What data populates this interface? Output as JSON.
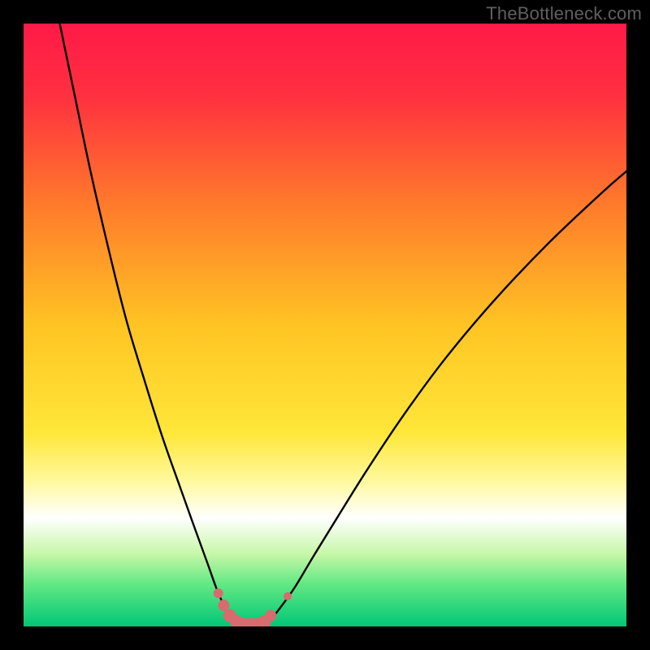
{
  "watermark": "TheBottleneck.com",
  "chart_data": {
    "type": "line",
    "title": "",
    "xlabel": "",
    "ylabel": "",
    "xlim": [
      0,
      100
    ],
    "ylim": [
      0,
      100
    ],
    "grid": false,
    "legend": false,
    "gradient_stops": [
      {
        "offset": 0.0,
        "color": "#ff1a47"
      },
      {
        "offset": 0.12,
        "color": "#ff3040"
      },
      {
        "offset": 0.3,
        "color": "#ff7a2b"
      },
      {
        "offset": 0.5,
        "color": "#ffc423"
      },
      {
        "offset": 0.68,
        "color": "#ffe73a"
      },
      {
        "offset": 0.76,
        "color": "#fff99f"
      },
      {
        "offset": 0.82,
        "color": "#ffffff"
      },
      {
        "offset": 0.88,
        "color": "#c6f7a7"
      },
      {
        "offset": 0.93,
        "color": "#62e884"
      },
      {
        "offset": 1.0,
        "color": "#00c776"
      }
    ],
    "series": [
      {
        "name": "bottleneck-curve-left",
        "x": [
          6.0,
          8.5,
          11.0,
          14.0,
          17.0,
          20.0,
          23.0,
          26.0,
          28.5,
          30.5,
          32.0,
          33.3,
          34.2,
          35.0
        ],
        "y": [
          100.0,
          88.0,
          76.0,
          63.0,
          51.0,
          41.0,
          31.5,
          23.0,
          16.0,
          10.5,
          6.3,
          3.3,
          1.4,
          0.35
        ]
      },
      {
        "name": "bottleneck-curve-right",
        "x": [
          40.0,
          41.0,
          42.5,
          45.0,
          48.0,
          52.0,
          57.0,
          63.0,
          70.0,
          78.0,
          87.0,
          96.0,
          100.0
        ],
        "y": [
          0.35,
          1.2,
          3.0,
          6.5,
          11.5,
          18.0,
          26.0,
          35.0,
          44.5,
          54.0,
          63.5,
          72.0,
          75.5
        ]
      }
    ],
    "markers": {
      "name": "highlight-dots",
      "color": "#d96a6e",
      "points": [
        {
          "x": 32.3,
          "y": 5.5,
          "r": 6
        },
        {
          "x": 33.2,
          "y": 3.5,
          "r": 7
        },
        {
          "x": 34.2,
          "y": 1.8,
          "r": 8
        },
        {
          "x": 35.3,
          "y": 0.8,
          "r": 8
        },
        {
          "x": 36.5,
          "y": 0.35,
          "r": 8
        },
        {
          "x": 37.7,
          "y": 0.35,
          "r": 8
        },
        {
          "x": 38.9,
          "y": 0.35,
          "r": 8
        },
        {
          "x": 40.0,
          "y": 0.8,
          "r": 8
        },
        {
          "x": 41.0,
          "y": 1.8,
          "r": 7
        },
        {
          "x": 43.8,
          "y": 5.0,
          "r": 5
        }
      ]
    }
  }
}
